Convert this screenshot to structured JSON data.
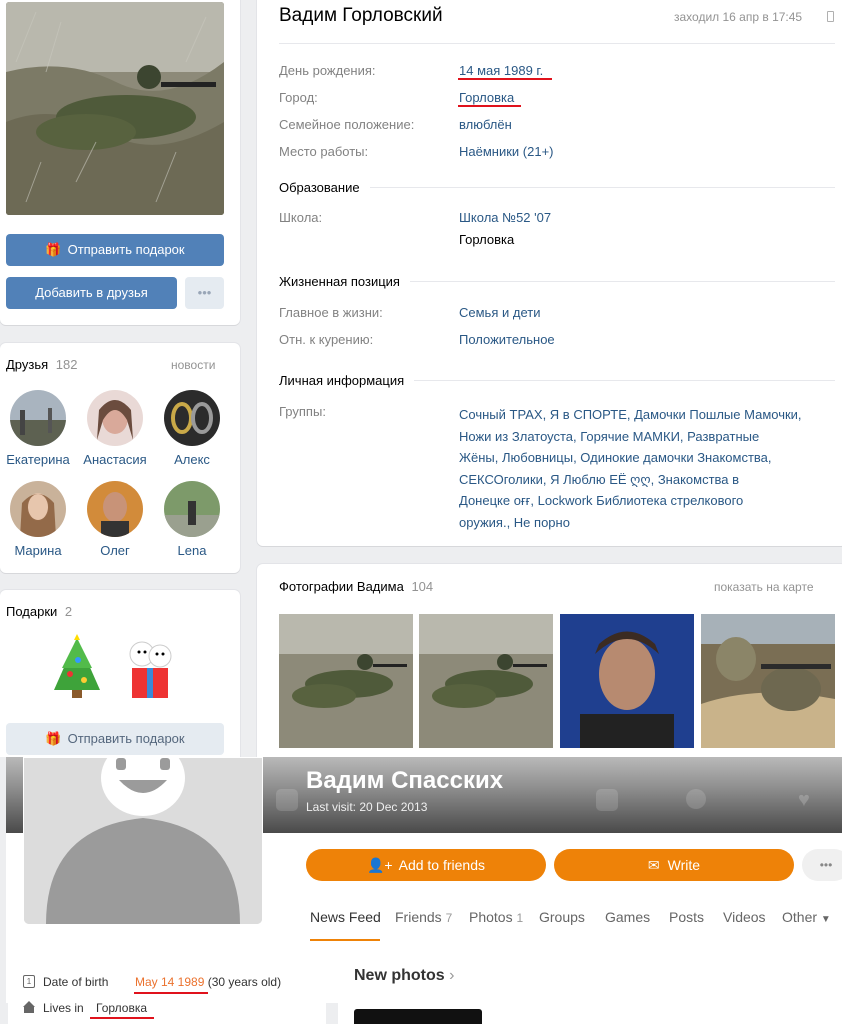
{
  "vk": {
    "send_gift_label": "Отправить подарок",
    "add_friend_label": "Добавить в друзья",
    "more_label": "•••",
    "profile": {
      "name": "Вадим Горловский",
      "last_seen": "заходил 16 апр в 17:45",
      "rows": [
        {
          "label": "День рождения:",
          "value": "14 мая 1989 г."
        },
        {
          "label": "Город:",
          "value": "Горловка"
        },
        {
          "label": "Семейное положение:",
          "value": "влюблён"
        },
        {
          "label": "Место работы:",
          "value": "Наёмники (21+)"
        }
      ],
      "education_title": "Образование",
      "school_label": "Школа:",
      "school_value": "Школа №52 '07",
      "school_city": "Горловка",
      "life_title": "Жизненная позиция",
      "life_rows": [
        {
          "label": "Главное в жизни:",
          "value": "Семья и дети"
        },
        {
          "label": "Отн. к курению:",
          "value": "Положительное"
        }
      ],
      "personal_title": "Личная информация",
      "groups_label": "Группы:",
      "groups_lines": [
        "Сочный ТРАХ, Я в СПОРТЕ, Дамочки Пошлые Мамочки,",
        "Ножи из Златоуста, Горячие МАМКИ, Развратные",
        "Жёны, Любовницы, Одинокие дамочки Знакомства,",
        "СЕКСОголики, Я Люблю ЕЁ ღღ, Знакомства в",
        "Донецке оғғ, Lockwork Библиотека стрелкового",
        "оружия., Не порно"
      ]
    },
    "friends": {
      "title": "Друзья",
      "count": "182",
      "news_link": "новости",
      "items": [
        {
          "name": "Екатерина"
        },
        {
          "name": "Анастасия"
        },
        {
          "name": "Алекс"
        },
        {
          "name": "Марина"
        },
        {
          "name": "Олег"
        },
        {
          "name": "Lena"
        }
      ]
    },
    "gifts": {
      "title": "Подарки",
      "count": "2",
      "send_label": "Отправить подарок"
    },
    "photos": {
      "title": "Фотографии Вадима",
      "count": "104",
      "map_link": "показать на карте"
    }
  },
  "ok": {
    "name": "Вадим Спасских",
    "last_visit": "Last visit: 20 Dec 2013",
    "add_friends_label": "Add to friends",
    "write_label": "Write",
    "more_label": "•••",
    "tabs": [
      {
        "label": "News Feed",
        "count": ""
      },
      {
        "label": "Friends",
        "count": "7"
      },
      {
        "label": "Photos",
        "count": "1"
      },
      {
        "label": "Groups",
        "count": ""
      },
      {
        "label": "Games",
        "count": ""
      },
      {
        "label": "Posts",
        "count": ""
      },
      {
        "label": "Videos",
        "count": ""
      },
      {
        "label": "Other",
        "count": ""
      }
    ],
    "dob_label": "Date of birth",
    "dob_value": "May 14 1989",
    "dob_age": "(30 years old)",
    "lives_label": "Lives in",
    "lives_value": "Горловка",
    "new_photos": "New photos"
  },
  "colors": {
    "vk_blue": "#5181b8",
    "vk_link": "#2a5885",
    "ok_orange": "#ee8208",
    "annotation_red": "#e0121c"
  }
}
